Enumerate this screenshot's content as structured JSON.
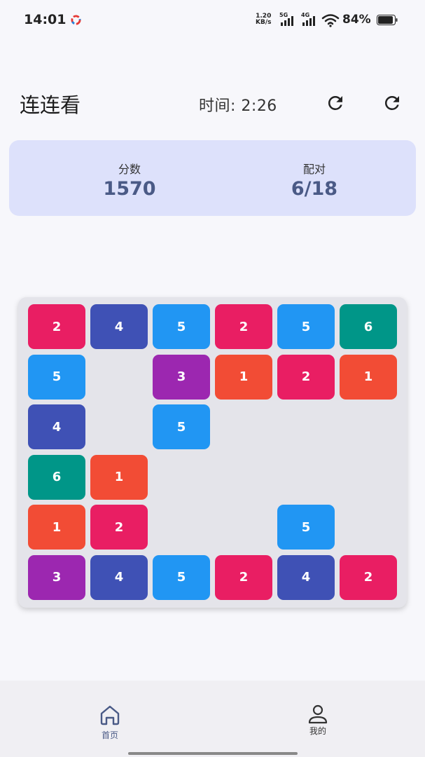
{
  "status_bar": {
    "time": "14:01",
    "net_speed_value": "1.20",
    "net_speed_unit": "KB/s",
    "signal_1": "5G",
    "signal_2": "4G",
    "battery": "84%"
  },
  "header": {
    "title": "连连看",
    "timer": "时间: 2:26",
    "refresh_icon": "refresh-icon",
    "restart_icon": "refresh-icon"
  },
  "stats": {
    "score_label": "分数",
    "score_value": "1570",
    "pairs_label": "配对",
    "pairs_value": "6/18"
  },
  "board": {
    "rows": 6,
    "cols": 6,
    "colors": {
      "1": "#f24c35",
      "2": "#e91e63",
      "3": "#9c27b0",
      "4": "#3f51b5",
      "5": "#2196f3",
      "6": "#009688"
    },
    "grid": [
      [
        2,
        4,
        5,
        2,
        5,
        6
      ],
      [
        5,
        null,
        3,
        1,
        2,
        1
      ],
      [
        4,
        null,
        5,
        null,
        null,
        null
      ],
      [
        6,
        1,
        null,
        null,
        null,
        null
      ],
      [
        1,
        2,
        null,
        null,
        5,
        null
      ],
      [
        3,
        4,
        5,
        2,
        4,
        2
      ]
    ]
  },
  "bottom_nav": {
    "items": [
      {
        "label": "首页",
        "icon": "home-icon",
        "active": true
      },
      {
        "label": "我的",
        "icon": "user-icon",
        "active": false
      }
    ]
  },
  "theme": {
    "accent": "#4a5a86",
    "card_bg": "#dde1fb"
  }
}
